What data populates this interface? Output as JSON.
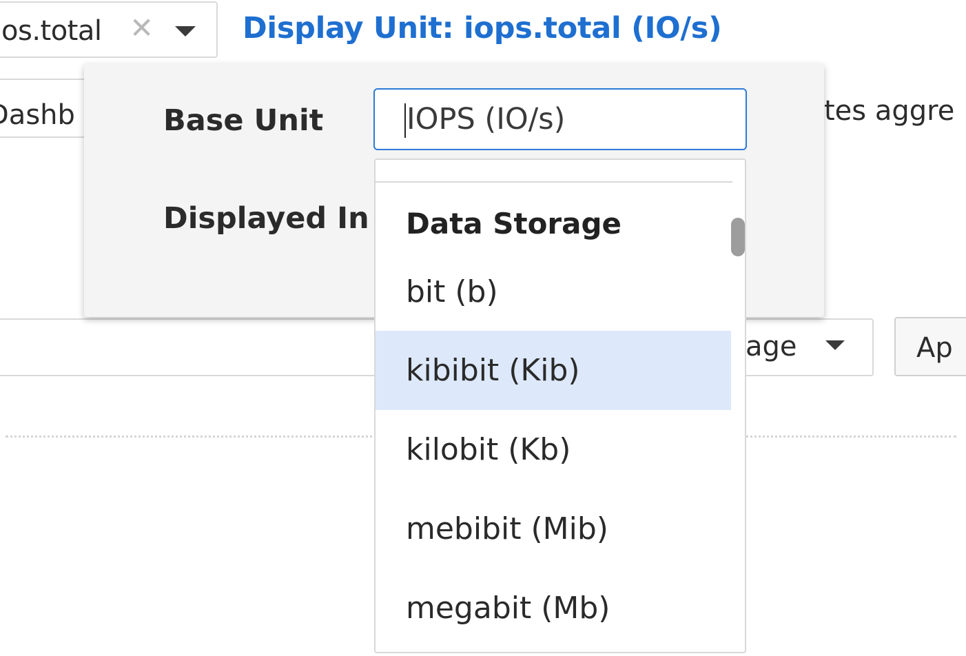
{
  "metric_select": {
    "value": "os.total",
    "clear_icon": "close-icon",
    "caret_icon": "caret-down-icon"
  },
  "display_unit_link": "Display Unit: iops.total (IO/s)",
  "background": {
    "dashboard_fragment": "Dashb",
    "aggregation_fragment": "tes aggre",
    "average_fragment": "age",
    "apply_fragment": "Ap"
  },
  "unit_panel": {
    "base_unit_label": "Base Unit",
    "base_unit_value": "IOPS (IO/s)",
    "displayed_in_label": "Displayed In"
  },
  "unit_dropdown": {
    "group_header": "Data Storage",
    "options": [
      {
        "label": "bit (b)",
        "highlighted": false
      },
      {
        "label": "kibibit (Kib)",
        "highlighted": true
      },
      {
        "label": "kilobit (Kb)",
        "highlighted": false
      },
      {
        "label": "mebibit (Mib)",
        "highlighted": false
      },
      {
        "label": "megabit (Mb)",
        "highlighted": false
      }
    ]
  },
  "colors": {
    "link": "#1e6fd0",
    "input_focus_border": "#2b7ad6",
    "option_highlight": "#dde9fa",
    "panel_bg": "#f4f4f4"
  }
}
